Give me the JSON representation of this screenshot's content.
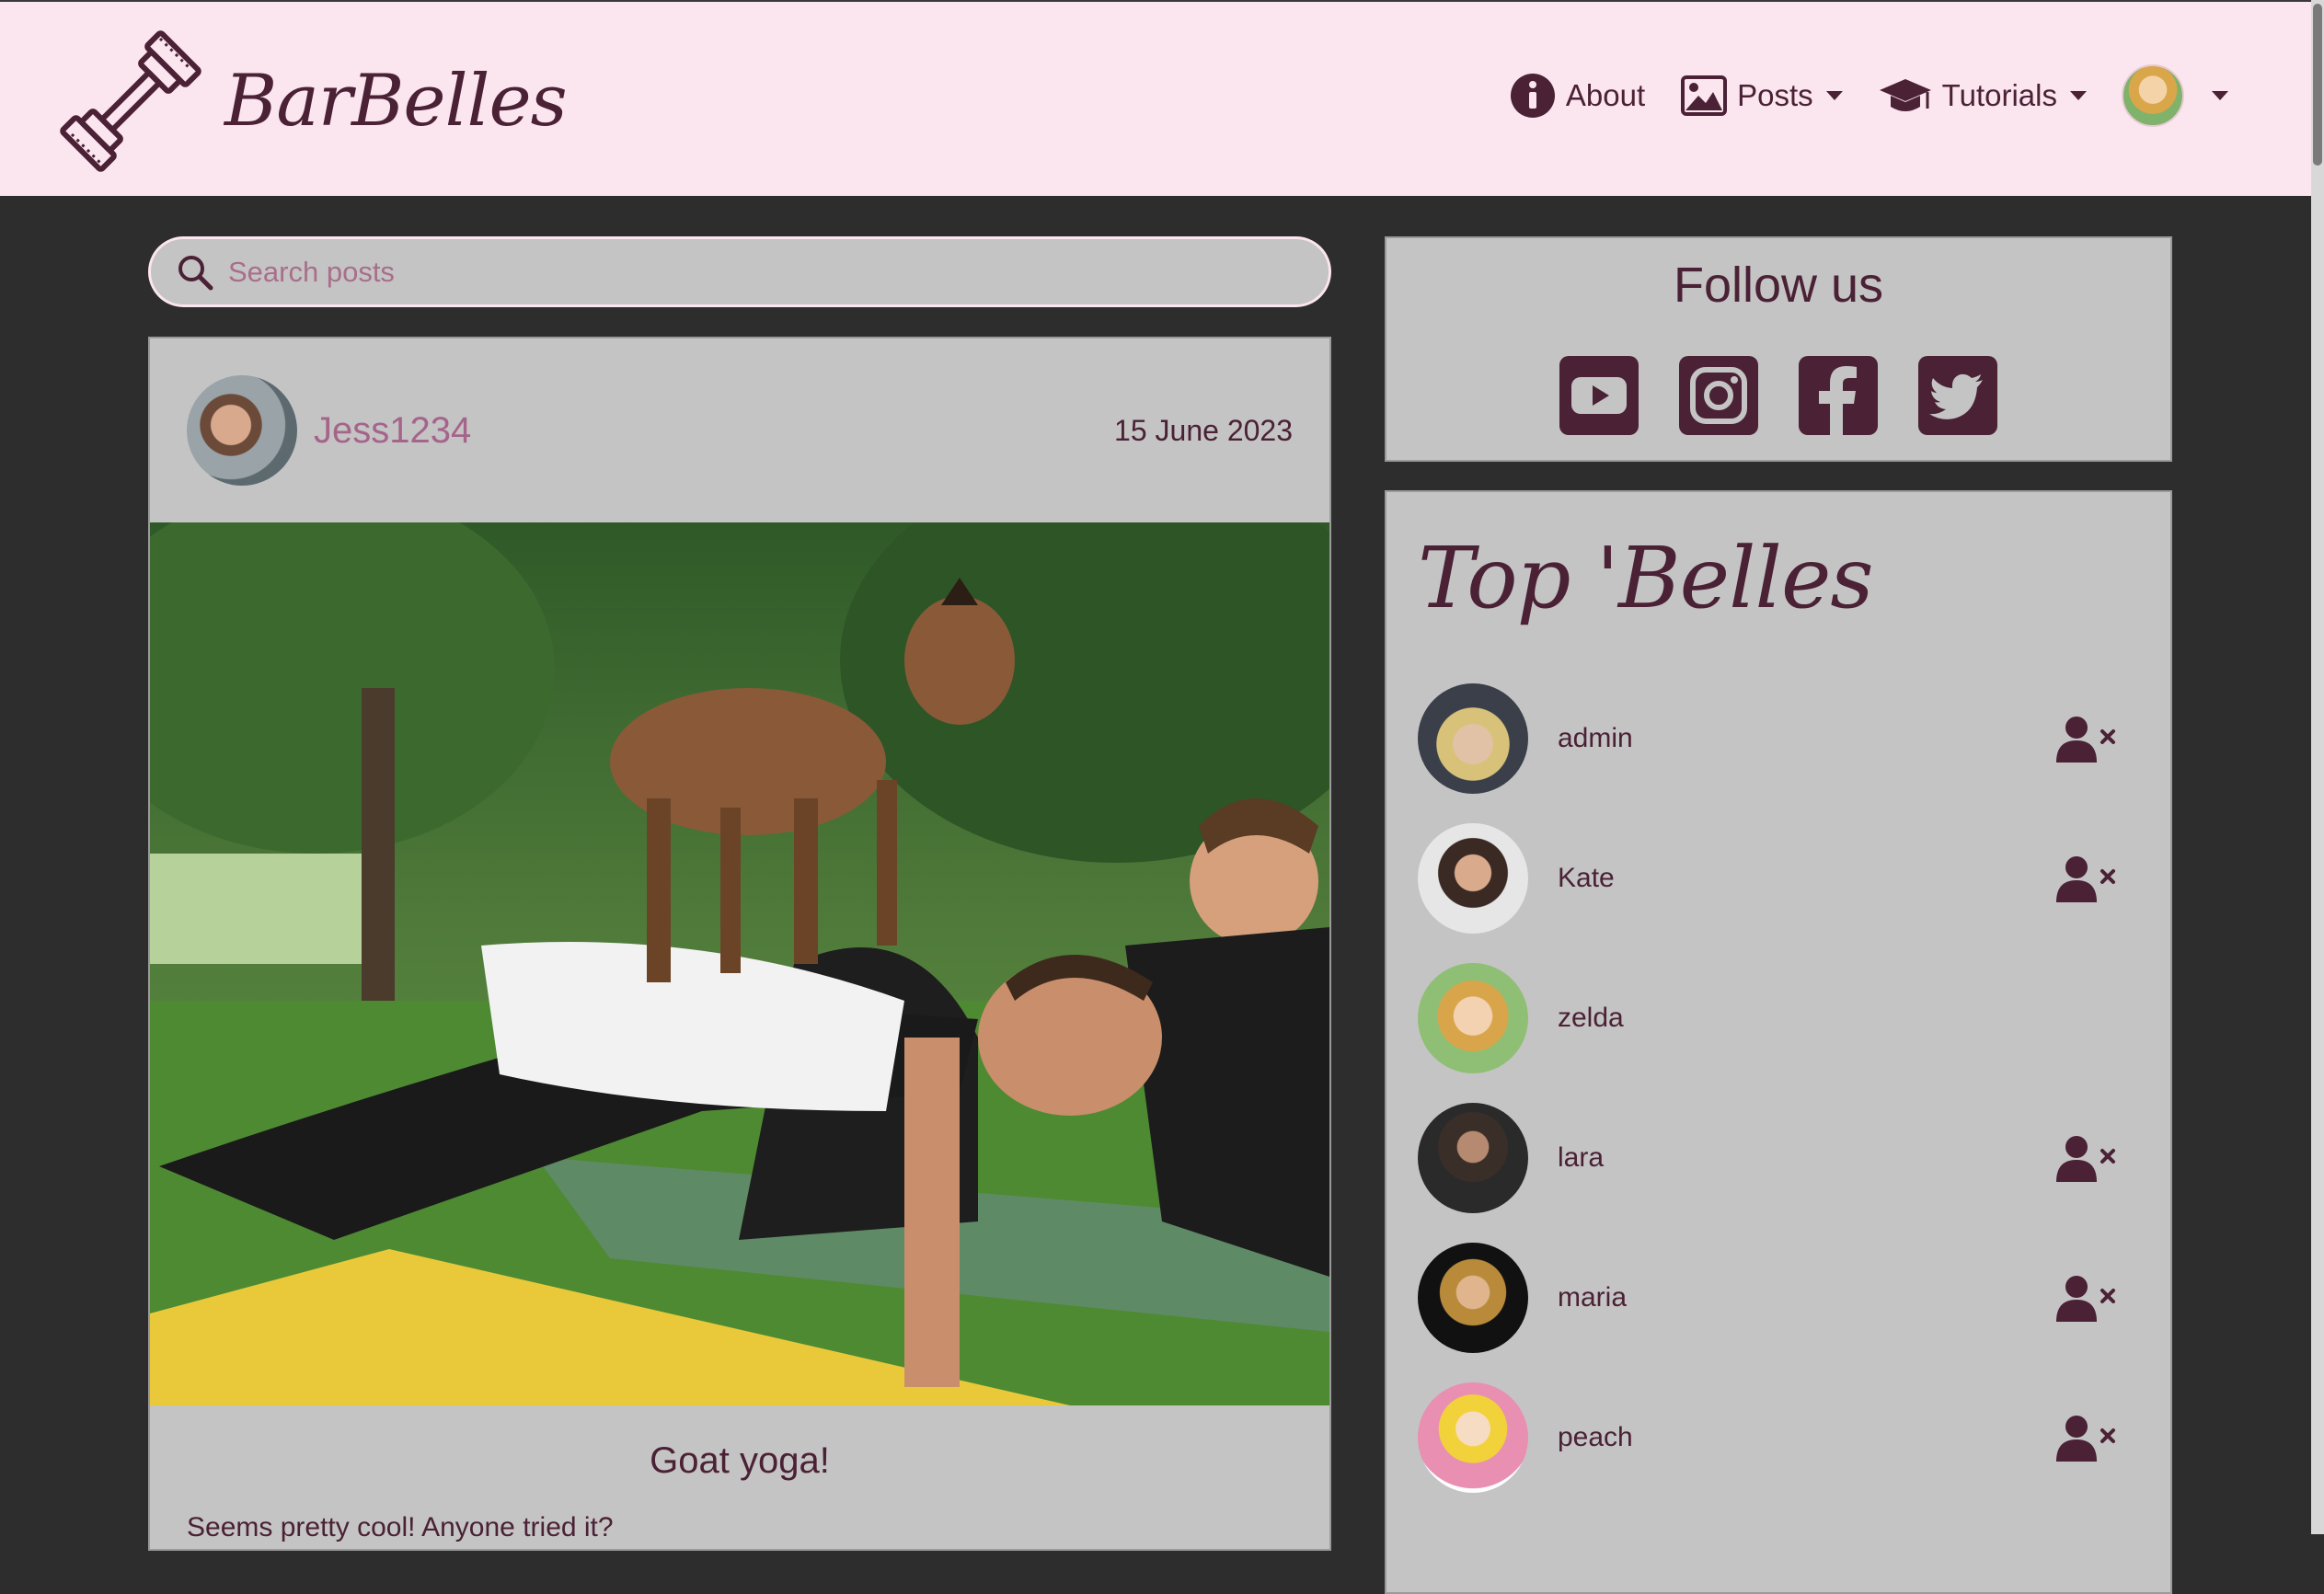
{
  "brand": {
    "name": "BarBelles"
  },
  "nav": {
    "about": "About",
    "posts": "Posts",
    "tutorials": "Tutorials"
  },
  "search": {
    "placeholder": "Search posts"
  },
  "post": {
    "author": "Jess1234",
    "date": "15 June 2023",
    "title": "Goat yoga!",
    "body": "Seems pretty cool! Anyone tried it?"
  },
  "follow": {
    "title": "Follow us",
    "icons": [
      "youtube-icon",
      "instagram-icon",
      "facebook-icon",
      "twitter-icon"
    ]
  },
  "top_belles": {
    "title": "Top 'Belles",
    "users": [
      {
        "name": "admin",
        "following": true
      },
      {
        "name": "Kate",
        "following": true
      },
      {
        "name": "zelda",
        "following": false
      },
      {
        "name": "lara",
        "following": true
      },
      {
        "name": "maria",
        "following": true
      },
      {
        "name": "peach",
        "following": true
      }
    ]
  },
  "colors": {
    "navbar_bg": "#fbe6ef",
    "page_bg": "#2d2d2d",
    "card_bg": "#c4c4c4",
    "primary": "#4a2135",
    "accent": "#a5648a"
  }
}
